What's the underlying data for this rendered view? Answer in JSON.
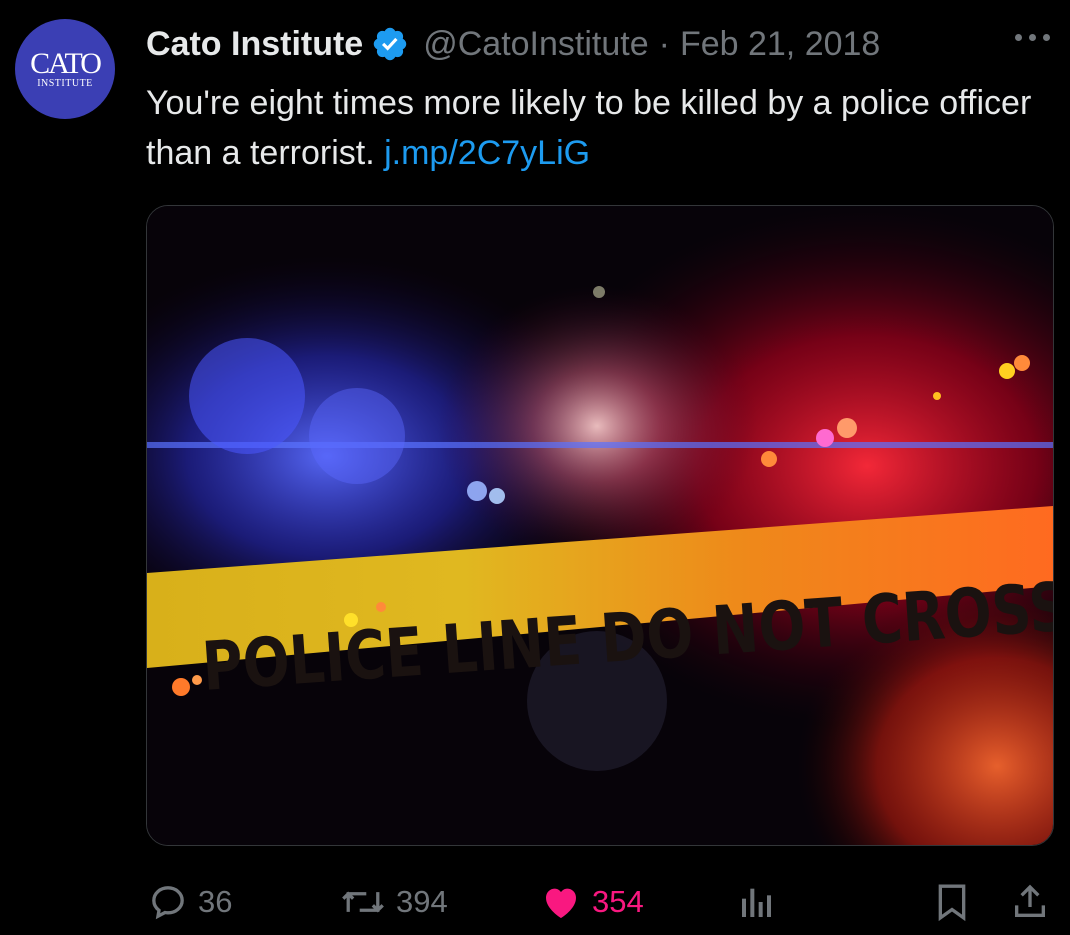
{
  "author": {
    "name": "Cato Institute",
    "handle": "@CatoInstitute",
    "separator": "·",
    "date": "Feb 21, 2018",
    "avatar_logo_main": "CATO",
    "avatar_logo_sub": "INSTITUTE",
    "verified_icon": "verified-badge-icon",
    "avatar_color": "#3b3fb4",
    "verified_color": "#1d9bf0"
  },
  "tweet": {
    "text": "You're eight times more likely to be killed by a police officer than a terrorist. ",
    "link": "j.mp/2C7yLiG"
  },
  "media": {
    "tape_text": "POLICE LINE DO NOT CROSS",
    "alt": "police-line-tape-image"
  },
  "actions": {
    "replies": "36",
    "reposts": "394",
    "likes": "354",
    "like_color": "#f91880"
  },
  "icons": [
    "more-icon",
    "reply-icon",
    "repost-icon",
    "like-icon",
    "views-icon",
    "bookmark-icon",
    "share-icon"
  ]
}
